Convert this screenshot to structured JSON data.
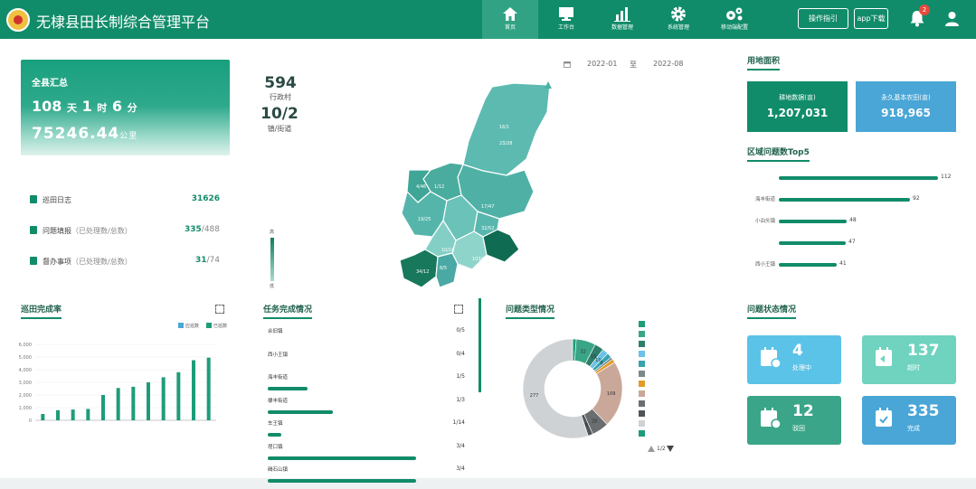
{
  "app": {
    "title": "无棣县田长制综合管理平台"
  },
  "nav": [
    {
      "label": "首页",
      "icon": "home-icon"
    },
    {
      "label": "工作台",
      "icon": "monitor-icon"
    },
    {
      "label": "数据管理",
      "icon": "bar-chart-icon"
    },
    {
      "label": "系统管理",
      "icon": "gear-icon"
    },
    {
      "label": "移动端配置",
      "icon": "gears-icon"
    }
  ],
  "header_buttons": {
    "guide": "操作指引",
    "app": "app下载"
  },
  "notifications": {
    "count": "2"
  },
  "summary": {
    "title": "全县汇总",
    "days": "108",
    "days_unit": "天",
    "hours": "1",
    "hours_unit": "时",
    "minutes": "6",
    "minutes_unit": "分",
    "distance": "75246.44",
    "distance_unit": "公里"
  },
  "stats": [
    {
      "label": "巡田日志",
      "note": "",
      "value": "31626",
      "total": ""
    },
    {
      "label": "问题填报",
      "note": "（已处理数/总数）",
      "value": "335",
      "total": "/488"
    },
    {
      "label": "督办事项",
      "note": "（已处理数/总数）",
      "value": "31",
      "total": "/74"
    }
  ],
  "center": {
    "villages": "594",
    "villages_label": "行政村",
    "towns": "10/2",
    "towns_label": "镇/街道",
    "date_from": "2022-01",
    "date_sep": "至",
    "date_to": "2022-08",
    "scale_high": "高",
    "scale_low": "低"
  },
  "map_labels": [
    "16/1",
    "23/28",
    "4/46",
    "1/12",
    "17/47",
    "19/25",
    "10/10",
    "32/52",
    "103/112",
    "34/12",
    "8/5"
  ],
  "land": {
    "title": "用地面积",
    "cards": [
      {
        "label": "耕地数据(亩)",
        "value": "1,207,031",
        "color": "#118c6a"
      },
      {
        "label": "永久基本农田(亩)",
        "value": "918,965",
        "color": "#4aa6d6"
      }
    ]
  },
  "top5": {
    "title": "区域问题数Top5",
    "rows": [
      {
        "name": "",
        "value": 112
      },
      {
        "name": "海丰街道",
        "value": 92
      },
      {
        "name": "小泊头镇",
        "value": 48
      },
      {
        "name": "",
        "value": 47
      },
      {
        "name": "西小王镇",
        "value": 41
      }
    ]
  },
  "patrol": {
    "title": "巡田完成率",
    "legend": [
      "应巡数",
      "已巡数"
    ],
    "yticks": [
      "6,000",
      "5,000",
      "4,000",
      "3,000",
      "2,000",
      "1,000",
      "0"
    ]
  },
  "chart_data": {
    "type": "bar",
    "title": "巡田完成率",
    "series": [
      {
        "name": "已巡数",
        "values": [
          500,
          800,
          850,
          900,
          2000,
          2550,
          2650,
          3000,
          3400,
          3800,
          4750,
          4950
        ]
      }
    ],
    "ylim": [
      0,
      6000
    ]
  },
  "tasks": {
    "title": "任务完成情况",
    "rows": [
      {
        "name": "佘旧镇",
        "value": "0/5",
        "pct": 0
      },
      {
        "name": "西小王镇",
        "value": "0/4",
        "pct": 0
      },
      {
        "name": "海丰街道",
        "value": "1/5",
        "pct": 0.2
      },
      {
        "name": "棣丰街道",
        "value": "1/3",
        "pct": 0.33
      },
      {
        "name": "车王镇",
        "value": "1/14",
        "pct": 0.07
      },
      {
        "name": "埕口镇",
        "value": "3/4",
        "pct": 0.75
      },
      {
        "name": "碣石山镇",
        "value": "3/4",
        "pct": 0.75
      }
    ]
  },
  "problem_types": {
    "title": "问题类型情况",
    "pager": "1/2",
    "slices": [
      {
        "label": "",
        "value": 6,
        "color": "#1e9c7a"
      },
      {
        "label": "",
        "value": 32,
        "color": "#3aa586"
      },
      {
        "label": "",
        "value": 15,
        "color": "#2d7f6b"
      },
      {
        "label": "",
        "value": 10,
        "color": "#6bc2e6"
      },
      {
        "label": "",
        "value": 8,
        "color": "#35a3b0"
      },
      {
        "label": "",
        "value": 4,
        "color": "#7a8a8a"
      },
      {
        "label": "",
        "value": 6,
        "color": "#e39b26"
      },
      {
        "label": "",
        "value": 109,
        "color": "#c9a899"
      },
      {
        "label": "",
        "value": 28,
        "color": "#6a6e71"
      },
      {
        "label": "",
        "value": 8,
        "color": "#4f5457"
      },
      {
        "label": "",
        "value": 277,
        "color": "#cfd2d4"
      }
    ],
    "legend": [
      {
        "label": "",
        "color": "#1e9c7a"
      },
      {
        "label": "",
        "color": "#3aa586"
      },
      {
        "label": "",
        "color": "#2d7f6b"
      },
      {
        "label": "",
        "color": "#6bc2e6"
      },
      {
        "label": "",
        "color": "#35a3b0"
      },
      {
        "label": "",
        "color": "#7a8a8a"
      },
      {
        "label": "",
        "color": "#e39b26"
      },
      {
        "label": "",
        "color": "#c9a899"
      },
      {
        "label": "",
        "color": "#6a6e71"
      },
      {
        "label": "",
        "color": "#4f5457"
      },
      {
        "label": "",
        "color": "#cfd2d4"
      },
      {
        "label": "",
        "color": "#1e9c7a"
      }
    ]
  },
  "status": {
    "title": "问题状态情况",
    "cards": [
      {
        "value": "4",
        "label": "处理中",
        "color": "#5cc3e8"
      },
      {
        "value": "137",
        "label": "超时",
        "color": "#6fd3bf"
      },
      {
        "value": "12",
        "label": "驳回",
        "color": "#3aa588"
      },
      {
        "value": "335",
        "label": "完成",
        "color": "#4aa6d6"
      }
    ]
  }
}
